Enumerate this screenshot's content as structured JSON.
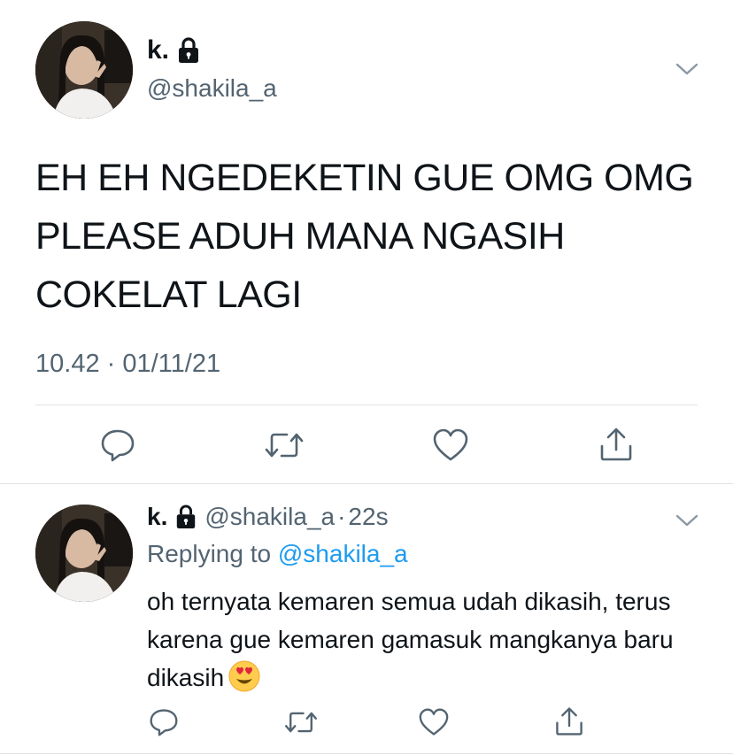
{
  "main_tweet": {
    "display_name": "k.",
    "handle": "@shakila_a",
    "text": "EH EH NGEDEKETIN GUE OMG OMG PLEASE ADUH MANA NGASIH COKELAT LAGI",
    "timestamp": "10.42 · 01/11/21",
    "actions": [
      "reply-icon",
      "retweet-icon",
      "like-icon",
      "share-icon"
    ]
  },
  "reply_tweet": {
    "display_name": "k.",
    "handle": "@shakila_a",
    "separator": "·",
    "time": "22s",
    "replying_prefix": "Replying to",
    "replying_to": "@shakila_a",
    "text": "oh ternyata kemaren semua udah dikasih, terus karena gue kemaren gamasuk mangkanya baru dikasih",
    "emoji": "smiling-face-with-heart-eyes",
    "actions": [
      "reply-icon",
      "retweet-icon",
      "like-icon",
      "share-icon"
    ]
  },
  "colors": {
    "text_primary": "#0f1419",
    "text_secondary": "#536471",
    "link": "#1d9bf0",
    "divider": "#dfe3e6",
    "icon": "#536471"
  }
}
